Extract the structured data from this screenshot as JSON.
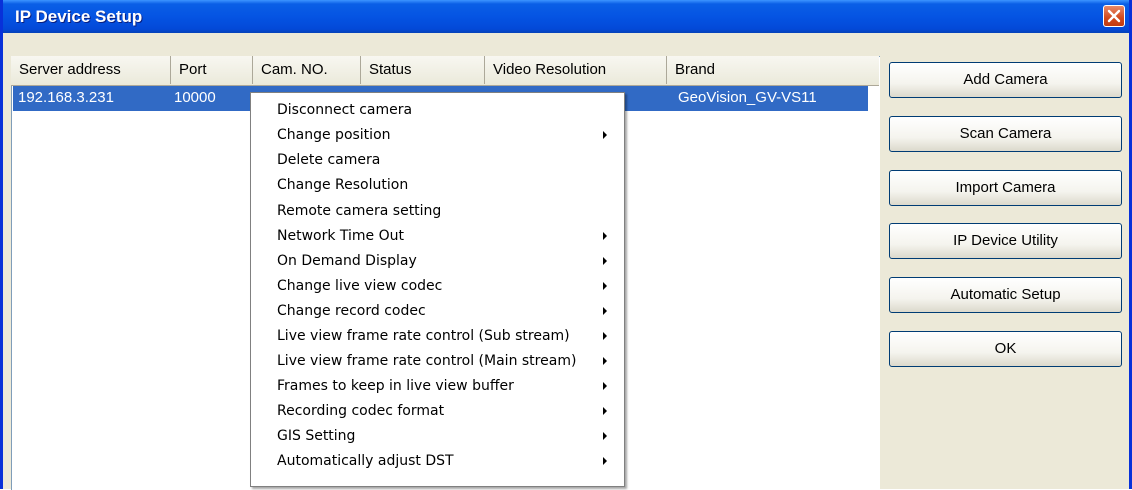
{
  "window": {
    "title": "IP Device Setup"
  },
  "table": {
    "columns": [
      "Server address",
      "Port",
      "Cam. NO.",
      "Status",
      "Video Resolution",
      "Brand"
    ],
    "rows": [
      {
        "server": "192.168.3.231",
        "port": "10000",
        "brand": "GeoVision_GV-VS11"
      }
    ]
  },
  "context_menu": {
    "items": [
      {
        "label": "Disconnect camera",
        "submenu": false
      },
      {
        "label": "Change position",
        "submenu": true
      },
      {
        "label": "Delete camera",
        "submenu": false
      },
      {
        "label": "Change Resolution",
        "submenu": false
      },
      {
        "label": "Remote camera setting",
        "submenu": false
      },
      {
        "label": "Network Time Out",
        "submenu": true
      },
      {
        "label": "On Demand Display",
        "submenu": true
      },
      {
        "label": "Change live view codec",
        "submenu": true
      },
      {
        "label": "Change record codec",
        "submenu": true
      },
      {
        "label": "Live view frame rate control (Sub stream)",
        "submenu": true
      },
      {
        "label": "Live view frame rate control (Main stream)",
        "submenu": true
      },
      {
        "label": "Frames to keep in live view buffer",
        "submenu": true
      },
      {
        "label": "Recording codec format",
        "submenu": true
      },
      {
        "label": "GIS Setting",
        "submenu": true
      },
      {
        "label": "Automatically adjust DST",
        "submenu": true
      }
    ]
  },
  "buttons": {
    "add_camera": "Add Camera",
    "scan_camera": "Scan Camera",
    "import_camera": "Import Camera",
    "ip_device_utility": "IP Device Utility",
    "automatic_setup": "Automatic Setup",
    "ok": "OK"
  },
  "colors": {
    "titlebar": "#0554e3",
    "selection": "#316ac5",
    "close_button": "#d2491c"
  }
}
